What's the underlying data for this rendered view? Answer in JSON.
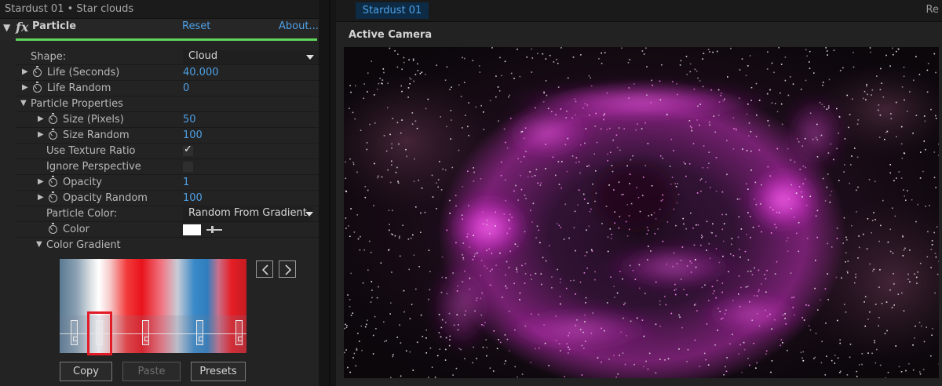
{
  "effect_controls": {
    "title": "Stardust 01 • Star clouds",
    "effect": {
      "name": "Particle",
      "reset_label": "Reset",
      "about_label": "About..."
    },
    "properties": {
      "shape": {
        "label": "Shape:",
        "value": "Cloud"
      },
      "life": {
        "label": "Life (Seconds)",
        "value": "40.000"
      },
      "life_random": {
        "label": "Life Random",
        "value": "0"
      },
      "particle_properties": {
        "label": "Particle Properties"
      },
      "size": {
        "label": "Size (Pixels)",
        "value": "50"
      },
      "size_random": {
        "label": "Size Random",
        "value": "100"
      },
      "use_texture_ratio": {
        "label": "Use Texture Ratio",
        "checked": true
      },
      "ignore_perspective": {
        "label": "Ignore Perspective",
        "checked": false
      },
      "opacity": {
        "label": "Opacity",
        "value": "1"
      },
      "opacity_random": {
        "label": "Opacity Random",
        "value": "100"
      },
      "particle_color": {
        "label": "Particle Color:",
        "value": "Random From Gradient"
      },
      "color": {
        "label": "Color",
        "value": "#ffffff"
      },
      "color_gradient": {
        "label": "Color Gradient"
      }
    },
    "gradient_stops": [
      {
        "position": 0.06
      },
      {
        "position": 0.2,
        "selected": true
      },
      {
        "position": 0.46
      },
      {
        "position": 0.76
      },
      {
        "position": 0.98
      }
    ],
    "buttons": {
      "copy": "Copy",
      "paste": "Paste",
      "presets": "Presets"
    }
  },
  "composition": {
    "tab": "Stardust 01",
    "tab_right": "Re",
    "view_label": "Active Camera"
  },
  "colors": {
    "accent_link": "#4ea0e6",
    "effect_underline": "#5fd65b",
    "selection_highlight": "#e21b26",
    "nebula_magenta": "#f040e0"
  }
}
